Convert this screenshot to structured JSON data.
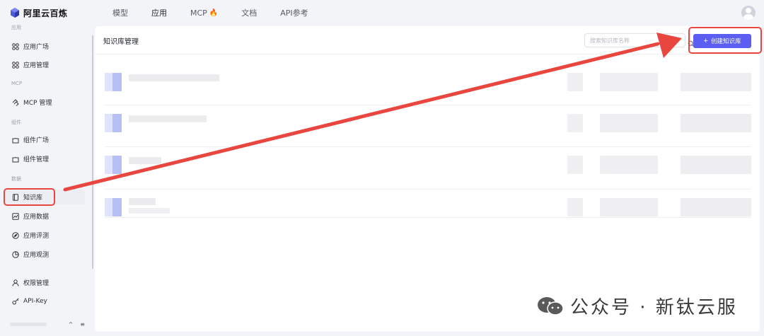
{
  "app": {
    "name": "阿里云百炼"
  },
  "topnav": {
    "tabs": [
      {
        "label": "模型"
      },
      {
        "label": "应用"
      },
      {
        "label": "MCP"
      },
      {
        "label": "文档"
      },
      {
        "label": "API参考"
      }
    ],
    "active_tab": "应用"
  },
  "sidebar": {
    "groups": {
      "app": "应用",
      "mcp": "MCP",
      "component": "组件",
      "data": "数据"
    },
    "items": [
      {
        "label": "应用广场",
        "icon": "grid-icon"
      },
      {
        "label": "应用管理",
        "icon": "grid-icon"
      },
      {
        "label": "MCP 管理",
        "icon": "mcp-icon"
      },
      {
        "label": "组件广场",
        "icon": "puzzle-icon"
      },
      {
        "label": "组件管理",
        "icon": "puzzle-icon"
      },
      {
        "label": "知识库",
        "icon": "book-icon"
      },
      {
        "label": "应用数据",
        "icon": "chart-icon"
      },
      {
        "label": "应用评测",
        "icon": "compass-icon"
      },
      {
        "label": "应用观测",
        "icon": "pie-icon"
      },
      {
        "label": "权限管理",
        "icon": "user-icon"
      },
      {
        "label": "API-Key",
        "icon": "key-icon"
      }
    ],
    "active_item": "知识库",
    "bottom": {
      "collapse": "^",
      "menu": "≡"
    }
  },
  "main": {
    "title": "知识库管理",
    "search": {
      "placeholder": "搜索知识库名称",
      "value": ""
    },
    "create_button": {
      "label": "创建知识库",
      "icon": "plus-icon"
    }
  },
  "watermark": {
    "text": "公众号 · 新钛云服"
  },
  "colors": {
    "accent": "#5b5ef0",
    "highlight": "#e8463f",
    "background": "#f3f4f8"
  }
}
